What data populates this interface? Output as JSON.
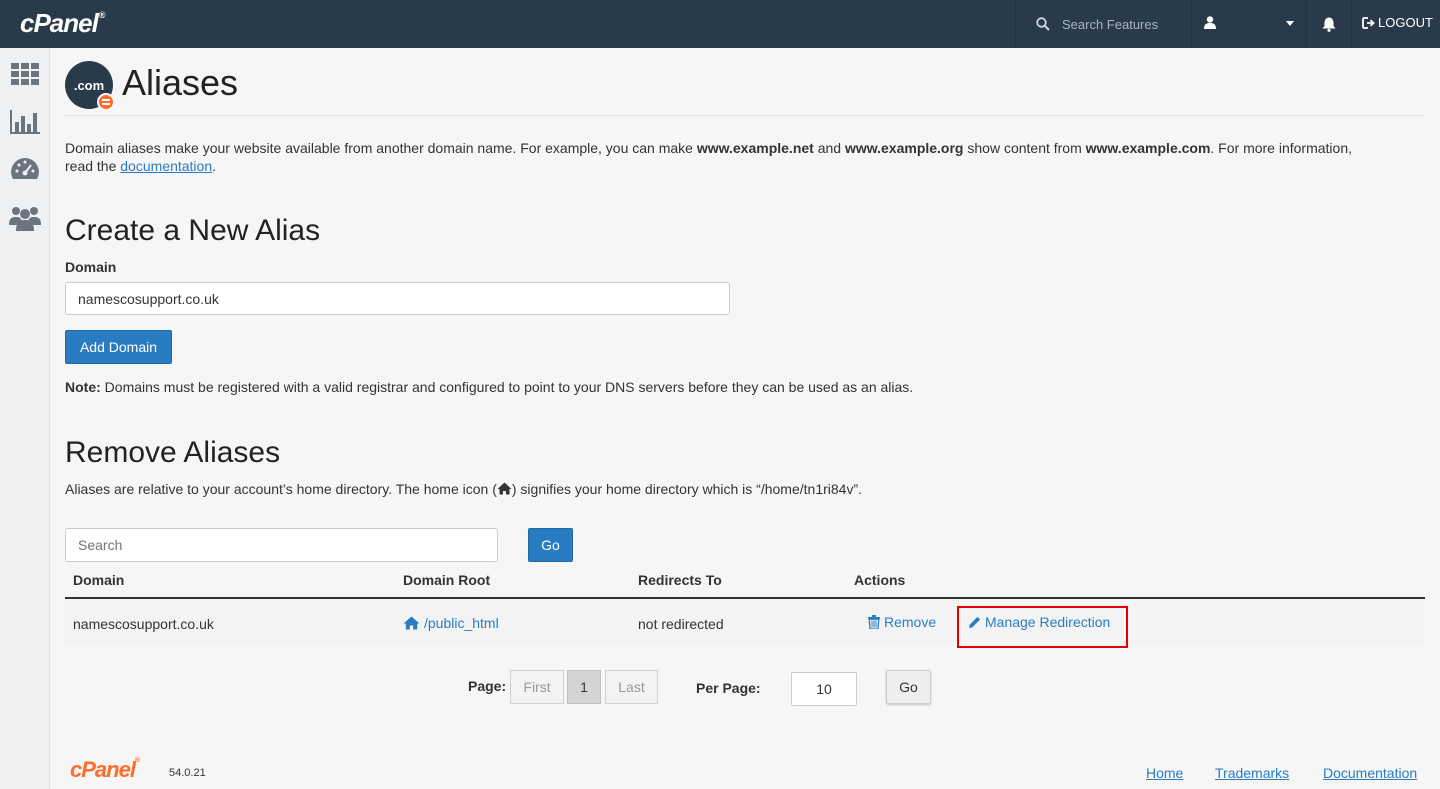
{
  "topbar": {
    "brand": "cPanel",
    "search_placeholder": "Search Features",
    "logout_label": "LOGOUT",
    "bg_color": "#293a4a"
  },
  "sidebar": {
    "items": [
      {
        "name": "grid-icon"
      },
      {
        "name": "stats-icon"
      },
      {
        "name": "dashboard-icon"
      },
      {
        "name": "users-icon"
      }
    ]
  },
  "page": {
    "icon_text": ".com",
    "title": "Aliases",
    "intro_1": "Domain aliases make your website available from another domain name. For example, you can make ",
    "intro_b1": "www.example.net",
    "intro_2": " and ",
    "intro_b2": "www.example.org",
    "intro_3": " show content from ",
    "intro_b3": "www.example.com",
    "intro_4": ". For more information, read the ",
    "intro_link": "documentation",
    "intro_5": "."
  },
  "create": {
    "heading": "Create a New Alias",
    "domain_label": "Domain",
    "domain_value": "namescosupport.co.uk",
    "add_button": "Add Domain",
    "note_bold": "Note:",
    "note_text": " Domains must be registered with a valid registrar and configured to point to your DNS servers before they can be used as an alias."
  },
  "remove": {
    "heading": "Remove Aliases",
    "desc_1": "Aliases are relative to your account’s home directory. The home icon (",
    "desc_2": ") signifies your home directory which is “/home/tn1ri84v”.",
    "search_placeholder": "Search",
    "go_button": "Go",
    "columns": [
      "Domain",
      "Domain Root",
      "Redirects To",
      "Actions"
    ],
    "rows": [
      {
        "domain": "namescosupport.co.uk",
        "root": "/public_html",
        "redirects": "not redirected",
        "remove": "Remove",
        "manage": "Manage Redirection"
      }
    ]
  },
  "pagination": {
    "page_label": "Page:",
    "first": "First",
    "current": "1",
    "last": "Last",
    "per_page_label": "Per Page:",
    "per_page_value": "10",
    "go": "Go"
  },
  "footer": {
    "logo": "cPanel",
    "version": "54.0.21",
    "links": [
      "Home",
      "Trademarks",
      "Documentation"
    ]
  },
  "colors": {
    "accent": "#2a7cc2",
    "brand_orange": "#ff6c2c",
    "highlight": "#e00000"
  }
}
